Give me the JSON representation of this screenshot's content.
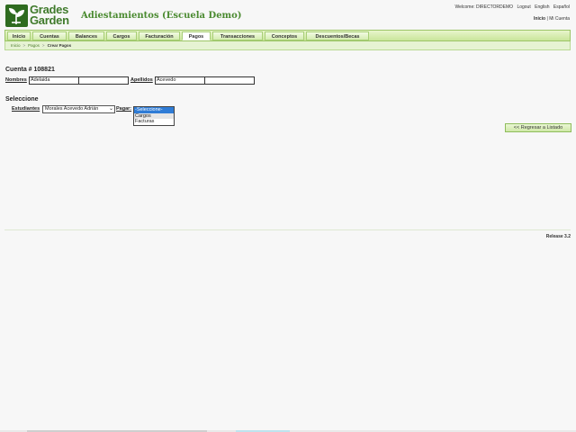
{
  "brand": {
    "line1": "Grades",
    "line2": "Garden",
    "app_title": "Adiestamientos (Escuela Demo)"
  },
  "topbar": {
    "welcome_prefix": "Welcome:",
    "username": "DIRECTORDEMO",
    "logout": "Logout",
    "lang_en": "English",
    "lang_es": "Español",
    "home": "Inicio",
    "sep": "|",
    "my_account": "Mi Cuenta"
  },
  "nav": {
    "tabs": [
      "Inicio",
      "Cuentas",
      "Balances",
      "Cargos",
      "Facturación",
      "Pagos",
      "Transacciones",
      "Conceptos",
      "Descuentos/Becas"
    ],
    "active_index": 5
  },
  "breadcrumb": {
    "items": [
      "Inicio",
      "Pagos"
    ],
    "sep": ">",
    "current": "Crear Pagos"
  },
  "account": {
    "title": "Cuenta # 108821",
    "nombres_label": "Nombres",
    "nombres_value": "Adelaida",
    "nombres_value2": "",
    "apellidos_label": "Apellidos",
    "apellidos_value": "Acevedo",
    "apellidos_value2": ""
  },
  "select_section": {
    "title": "Seleccione",
    "students_label": "Estudiantes",
    "student_selected": "Morales Acevedo Adrián",
    "pagar_label": "Pagar:",
    "pagar_options": [
      "-Seleccione-",
      "Cargos",
      "Facturas"
    ],
    "pagar_selected_index": 0
  },
  "back_button": "<< Regresar a Listado",
  "release": "Release 3.2",
  "colors": {
    "brand_green": "#3f7a2b",
    "nav_green": "#c9e59a",
    "select_blue": "#2f7cd6"
  }
}
